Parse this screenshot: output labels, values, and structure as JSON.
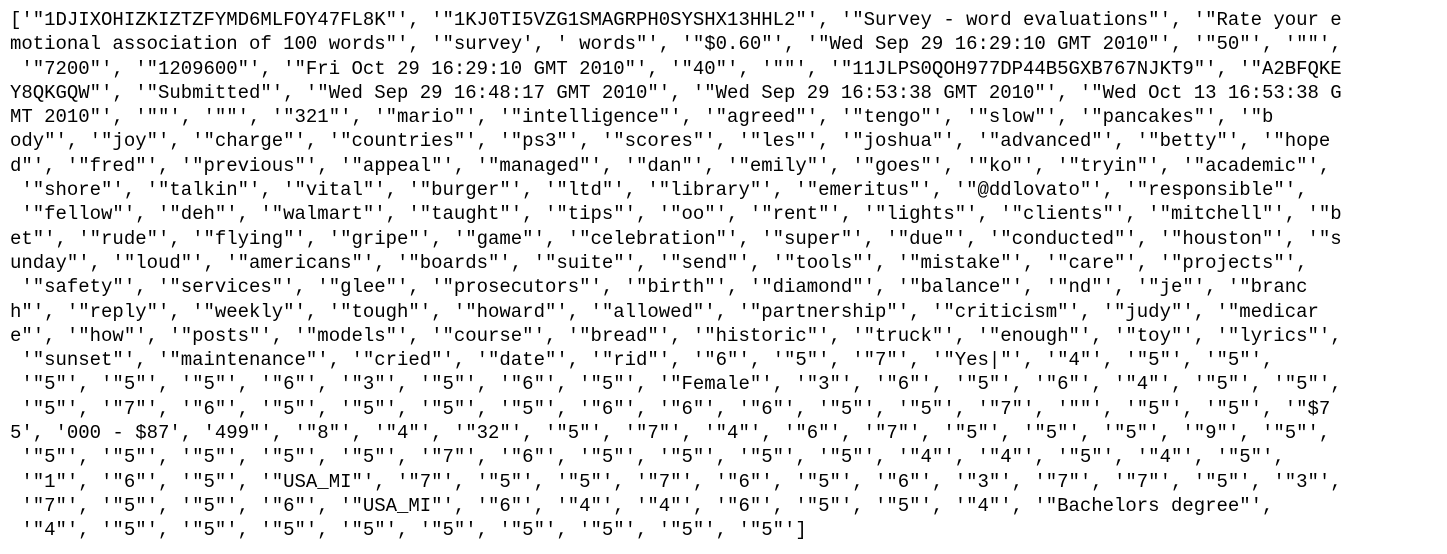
{
  "lines": [
    "['\"1DJIXOHIZKIZTZFYMD6MLFOY47FL8K\"', '\"1KJ0TI5VZG1SMAGRPH0SYSHX13HHL2\"', '\"Survey - word evaluations\"', '\"Rate your e",
    "motional association of 100 words\"', '\"survey', ' words\"', '\"$0.60\"', '\"Wed Sep 29 16:29:10 GMT 2010\"', '\"50\"', '\"\"',",
    " '\"7200\"', '\"1209600\"', '\"Fri Oct 29 16:29:10 GMT 2010\"', '\"40\"', '\"\"', '\"11JLPS0QOH977DP44B5GXB767NJKT9\"', '\"A2BFQKE",
    "Y8QKGQW\"', '\"Submitted\"', '\"Wed Sep 29 16:48:17 GMT 2010\"', '\"Wed Sep 29 16:53:38 GMT 2010\"', '\"Wed Oct 13 16:53:38 G",
    "MT 2010\"', '\"\"', '\"\"', '\"321\"', '\"mario\"', '\"intelligence\"', '\"agreed\"', '\"tengo\"', '\"slow\"', '\"pancakes\"', '\"b",
    "ody\"', '\"joy\"', '\"charge\"', '\"countries\"', '\"ps3\"', '\"scores\"', '\"les\"', '\"joshua\"', '\"advanced\"', '\"betty\"', '\"hope",
    "d\"', '\"fred\"', '\"previous\"', '\"appeal\"', '\"managed\"', '\"dan\"', '\"emily\"', '\"goes\"', '\"ko\"', '\"tryin\"', '\"academic\"',",
    " '\"shore\"', '\"talkin\"', '\"vital\"', '\"burger\"', '\"ltd\"', '\"library\"', '\"emeritus\"', '\"@ddlovato\"', '\"responsible\"',",
    " '\"fellow\"', '\"deh\"', '\"walmart\"', '\"taught\"', '\"tips\"', '\"oo\"', '\"rent\"', '\"lights\"', '\"clients\"', '\"mitchell\"', '\"b",
    "et\"', '\"rude\"', '\"flying\"', '\"gripe\"', '\"game\"', '\"celebration\"', '\"super\"', '\"due\"', '\"conducted\"', '\"houston\"', '\"s",
    "unday\"', '\"loud\"', '\"americans\"', '\"boards\"', '\"suite\"', '\"send\"', '\"tools\"', '\"mistake\"', '\"care\"', '\"projects\"',",
    " '\"safety\"', '\"services\"', '\"glee\"', '\"prosecutors\"', '\"birth\"', '\"diamond\"', '\"balance\"', '\"nd\"', '\"je\"', '\"branc",
    "h\"', '\"reply\"', '\"weekly\"', '\"tough\"', '\"howard\"', '\"allowed\"', '\"partnership\"', '\"criticism\"', '\"judy\"', '\"medicar",
    "e\"', '\"how\"', '\"posts\"', '\"models\"', '\"course\"', '\"bread\"', '\"historic\"', '\"truck\"', '\"enough\"', '\"toy\"', '\"lyrics\"',",
    " '\"sunset\"', '\"maintenance\"', '\"cried\"', '\"date\"', '\"rid\"', '\"6\"', '\"5\"', '\"7\"', '\"Yes|\"', '\"4\"', '\"5\"', '\"5\"',",
    " '\"5\"', '\"5\"', '\"5\"', '\"6\"', '\"3\"', '\"5\"', '\"6\"', '\"5\"', '\"Female\"', '\"3\"', '\"6\"', '\"5\"', '\"6\"', '\"4\"', '\"5\"', '\"5\"',",
    " '\"5\"', '\"7\"', '\"6\"', '\"5\"', '\"5\"', '\"5\"', '\"5\"', '\"6\"', '\"6\"', '\"6\"', '\"5\"', '\"5\"', '\"7\"', '\"\"', '\"5\"', '\"5\"', '\"$7",
    "5', '000 - $87', '499\"', '\"8\"', '\"4\"', '\"32\"', '\"5\"', '\"7\"', '\"4\"', '\"6\"', '\"7\"', '\"5\"', '\"5\"', '\"5\"', '\"9\"', '\"5\"',",
    " '\"5\"', '\"5\"', '\"5\"', '\"5\"', '\"5\"', '\"7\"', '\"6\"', '\"5\"', '\"5\"', '\"5\"', '\"5\"', '\"4\"', '\"4\"', '\"5\"', '\"4\"', '\"5\"',",
    " '\"1\"', '\"6\"', '\"5\"', '\"USA_MI\"', '\"7\"', '\"5\"', '\"5\"', '\"7\"', '\"6\"', '\"5\"', '\"6\"', '\"3\"', '\"7\"', '\"7\"', '\"5\"', '\"3\"',",
    " '\"7\"', '\"5\"', '\"5\"', '\"6\"', '\"USA_MI\"', '\"6\"', '\"4\"', '\"4\"', '\"6\"', '\"5\"', '\"5\"', '\"4\"', '\"Bachelors degree\"',",
    " '\"4\"', '\"5\"', '\"5\"', '\"5\"', '\"5\"', '\"5\"', '\"5\"', '\"5\"', '\"5\"', '\"5\"']"
  ]
}
